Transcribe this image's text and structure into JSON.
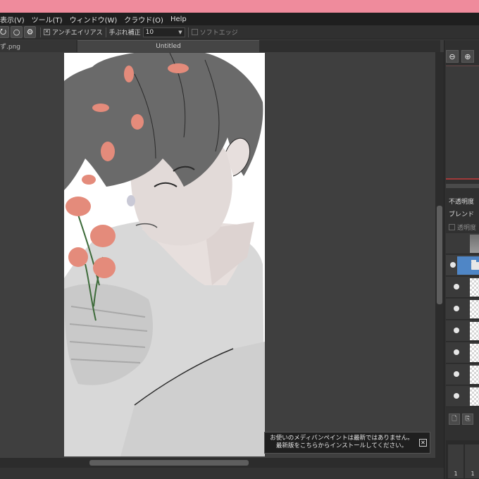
{
  "menu": {
    "items": [
      "表示(V)",
      "ツール(T)",
      "ウィンドウ(W)",
      "クラウド(O)",
      "Help"
    ]
  },
  "toolbar": {
    "antialias_label": "アンチエイリアス",
    "stabilizer_label": "手ぶれ補正",
    "stabilizer_value": "10",
    "soft_edge_label": "ソフトエッジ",
    "antialias_checked": true,
    "soft_edge_checked": false
  },
  "tabs": {
    "file_tab": "ず.png",
    "active_tab": "Untitled"
  },
  "layer_panel": {
    "opacity_label": "不透明度",
    "blend_label": "ブレンド",
    "protect_alpha_label": "透明度",
    "selected_color": "#4f86c6"
  },
  "brush_panel": {
    "cell_labels": [
      "1",
      "1"
    ]
  },
  "notification": {
    "line1": "お使いのメディバンペイントは最新ではありません。",
    "line2": "最新版をこちらからインストールしてください。"
  },
  "icons": {
    "lasso": "lasso-icon",
    "brush_settings": "gear-icon",
    "zoom_in": "zoom-in-icon",
    "zoom_out": "zoom-out-icon",
    "close": "close-icon",
    "new_layer": "new-layer-icon",
    "copy_layer": "copy-layer-icon"
  },
  "colors": {
    "titlebar": "#ef8b9c",
    "petal": "#e48b7b",
    "hair": "#6a6a6a"
  }
}
